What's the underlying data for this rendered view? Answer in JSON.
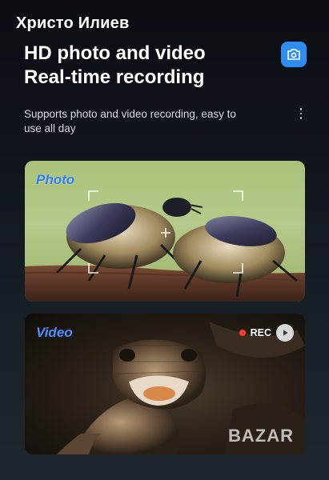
{
  "watermark_user": "Христо Илиев",
  "hero": {
    "line1": "HD photo and video",
    "line2": "Real-time recording"
  },
  "description": "Supports photo and video recording, easy to use all day",
  "icons": {
    "camera": "camera-icon",
    "more": "more-vertical-icon",
    "play": "play-icon",
    "focus": "focus-frame-icon"
  },
  "colors": {
    "accent": "#2f8cf0",
    "card_title": "#2f7ef0",
    "rec_dot": "#ff3b30"
  },
  "photo_card": {
    "title": "Photo"
  },
  "video_card": {
    "title": "Video",
    "rec_label": "REC"
  },
  "watermark_logo": "BAZAR"
}
